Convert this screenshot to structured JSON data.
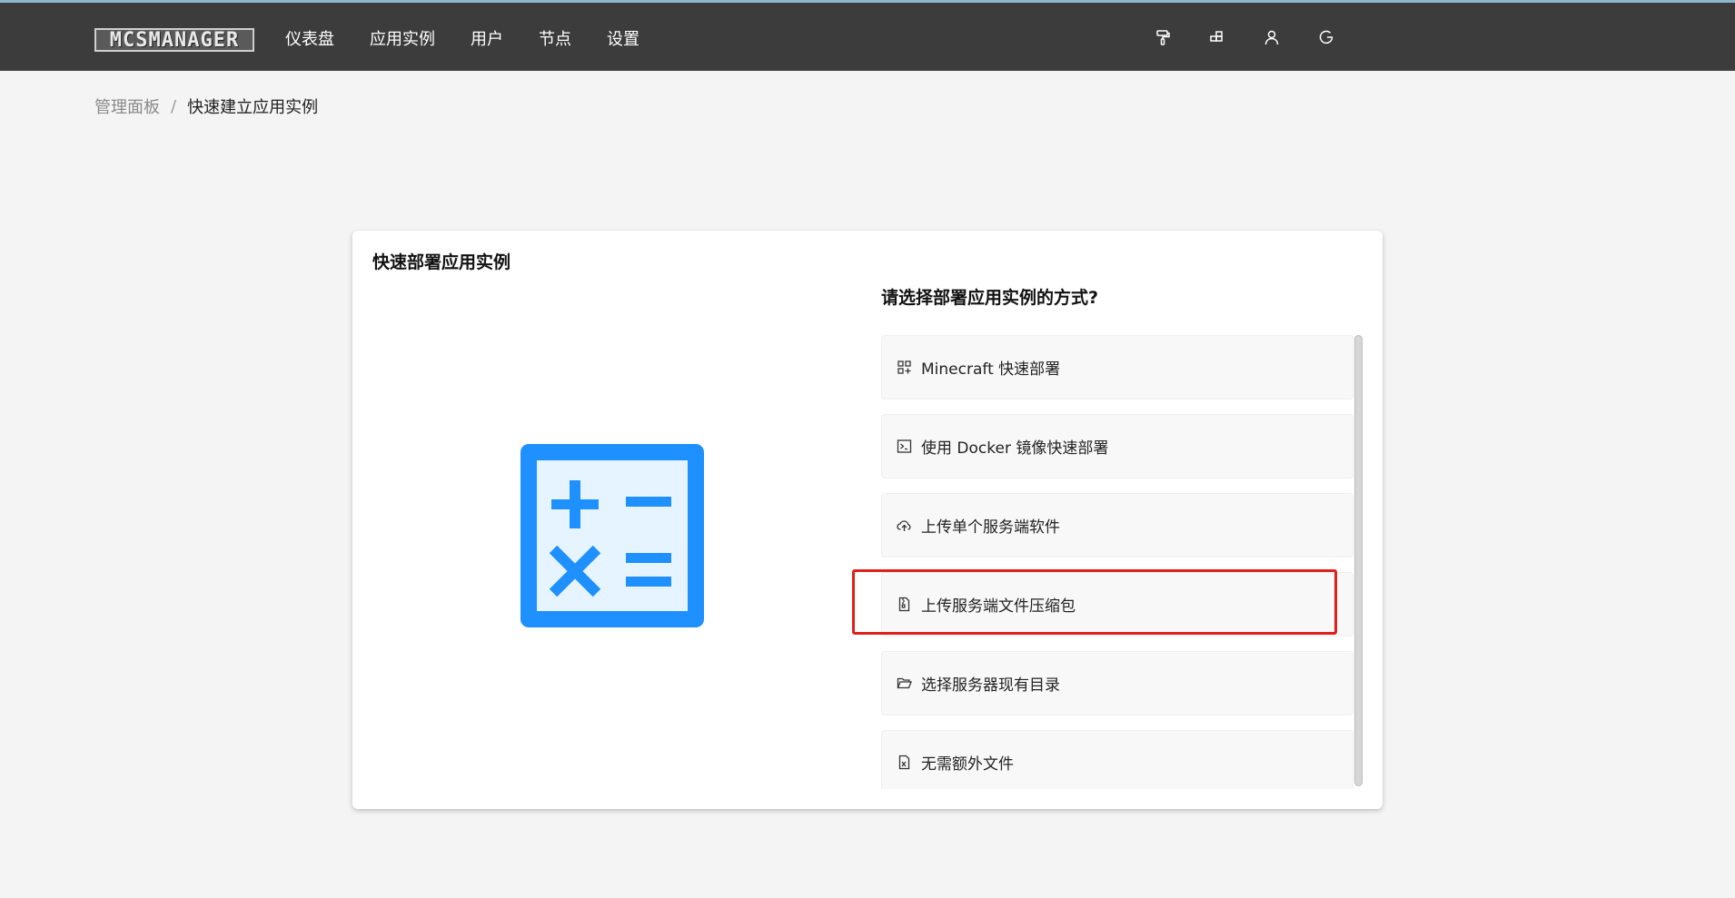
{
  "header": {
    "logo": "MCSMANAGER",
    "nav": [
      "仪表盘",
      "应用实例",
      "用户",
      "节点",
      "设置"
    ],
    "icons": [
      "paint-roller-icon",
      "puzzle-icon",
      "user-icon",
      "logout-icon"
    ]
  },
  "breadcrumb": {
    "root": "管理面板",
    "separator": "/",
    "current": "快速建立应用实例"
  },
  "card": {
    "title": "快速部署应用实例",
    "question": "请选择部署应用实例的方式?",
    "illustration": "calculator-icon",
    "accent_color": "#1f90ff",
    "options": [
      {
        "label": "Minecraft 快速部署",
        "icon": "app-grid-icon"
      },
      {
        "label": "使用 Docker 镜像快速部署",
        "icon": "terminal-icon"
      },
      {
        "label": "上传单个服务端软件",
        "icon": "cloud-upload-icon"
      },
      {
        "label": "上传服务端文件压缩包",
        "icon": "file-zip-icon"
      },
      {
        "label": "选择服务器现有目录",
        "icon": "folder-open-icon"
      },
      {
        "label": "无需额外文件",
        "icon": "file-excel-icon"
      }
    ],
    "highlighted_option": "上传服务端文件压缩包",
    "highlight_color": "#e0201c"
  }
}
